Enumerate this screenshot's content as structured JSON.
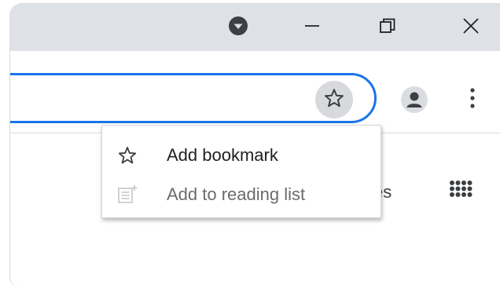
{
  "titlebar": {
    "profile_menu_icon": "chevron-down-circle-icon",
    "minimize_icon": "minimize-icon",
    "restore_icon": "restore-icon",
    "close_icon": "close-icon"
  },
  "toolbar": {
    "bookmark_icon": "star-outline-icon",
    "avatar_icon": "person-icon",
    "menu_icon": "vertical-dots-icon"
  },
  "page": {
    "partial_text": "es",
    "apps_icon": "apps-grid-icon"
  },
  "bookmark_menu": {
    "items": [
      {
        "label": "Add bookmark",
        "icon": "star-outline-icon",
        "enabled": true
      },
      {
        "label": "Add to reading list",
        "icon": "reading-list-icon",
        "enabled": false
      }
    ]
  },
  "colors": {
    "titlebar_bg": "#dee1e6",
    "omnibox_focus": "#1a73e8",
    "star_button_bg": "#d7d9dd",
    "dark_icon": "#3c4043",
    "disabled_text": "#6b6b6b"
  }
}
